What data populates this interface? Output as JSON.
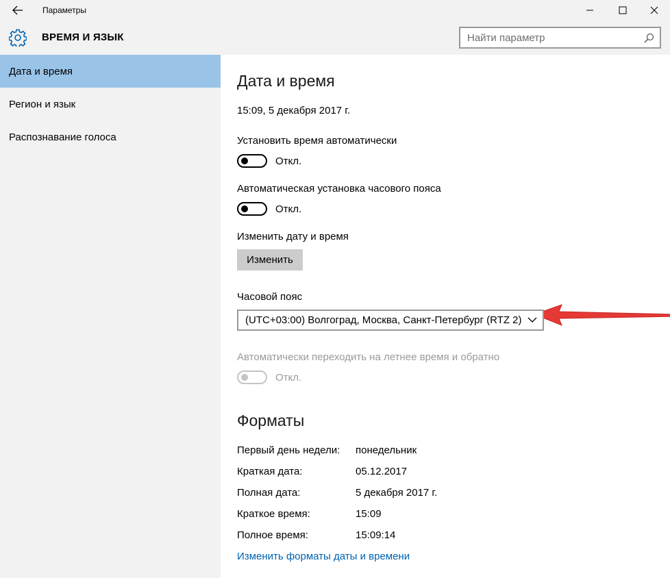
{
  "window": {
    "title": "Параметры"
  },
  "header": {
    "title": "ВРЕМЯ И ЯЗЫК",
    "search_placeholder": "Найти параметр"
  },
  "sidebar": {
    "items": [
      {
        "label": "Дата и время",
        "active": true
      },
      {
        "label": "Регион и язык",
        "active": false
      },
      {
        "label": "Распознавание голоса",
        "active": false
      }
    ]
  },
  "datetime": {
    "heading": "Дата и время",
    "current": "15:09, 5 декабря 2017 г.",
    "auto_time_label": "Установить время автоматически",
    "auto_time_state": "Откл.",
    "auto_tz_label": "Автоматическая установка часового пояса",
    "auto_tz_state": "Откл.",
    "change_label": "Изменить дату и время",
    "change_button": "Изменить",
    "timezone_label": "Часовой пояс",
    "timezone_value": "(UTC+03:00) Волгоград, Москва, Санкт-Петербург (RTZ 2)",
    "dst_label": "Автоматически переходить на летнее время и обратно",
    "dst_state": "Откл."
  },
  "formats": {
    "heading": "Форматы",
    "rows": [
      {
        "label": "Первый день недели:",
        "value": "понедельник"
      },
      {
        "label": "Краткая дата:",
        "value": "05.12.2017"
      },
      {
        "label": "Полная дата:",
        "value": "5 декабря 2017 г."
      },
      {
        "label": "Краткое время:",
        "value": "15:09"
      },
      {
        "label": "Полное время:",
        "value": "15:09:14"
      }
    ],
    "change_link": "Изменить форматы даты и времени"
  },
  "colors": {
    "accent": "#0063b1",
    "sidebar_active": "#99c4e8",
    "annotation_arrow": "#e53935"
  }
}
